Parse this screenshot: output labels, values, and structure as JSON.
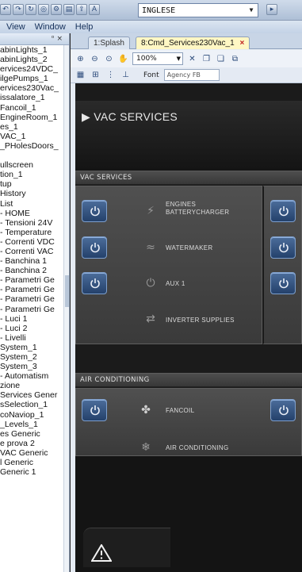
{
  "toolbar": {
    "language": "INGLESE"
  },
  "menu": {
    "items": [
      "View",
      "Window",
      "Help"
    ]
  },
  "left_panel": {
    "header": "&#x2d7; ×",
    "items": [
      "abinLights_1",
      "abinLights_2",
      "ervices24VDC_",
      "ilgePumps_1",
      "ervices230Vac_",
      "issalatore_1",
      "Fancoil_1",
      "EngineRoom_1",
      "es_1",
      "VAC_1",
      "_PHolesDoors_",
      "",
      "ullscreen",
      "tion_1",
      "tup",
      "History",
      "List",
      "- HOME",
      "- Tensioni 24V",
      "- Temperature",
      "- Correnti VDC",
      "- Correnti VAC",
      "- Banchina 1",
      "- Banchina 2",
      "- Parametri Ge",
      "- Parametri Ge",
      "- Parametri Ge",
      "- Parametri Ge",
      "- Luci 1",
      "- Luci 2",
      "- Livelli",
      "System_1",
      "System_2",
      "System_3",
      "- Automatism",
      "zione",
      "Services Gener",
      "sSelection_1",
      "coNaviop_1",
      "_Levels_1",
      "es Generic",
      "e prova 2",
      "VAC Generic",
      "l Generic",
      "Generic 1"
    ]
  },
  "tabs": [
    {
      "label": "1:Splash"
    },
    {
      "label": "8:Cmd_Services230Vac_1",
      "close": "×"
    }
  ],
  "zoombar": {
    "zoom": "100%"
  },
  "fontbar": {
    "label": "Font",
    "font_value": "Agency FB"
  },
  "page": {
    "title": "▶ VAC SERVICES",
    "sections": {
      "vac_services": "VAC SERVICES",
      "air_conditioning": "AIR CONDITIONING"
    },
    "vac_rows": [
      {
        "label_line1": "ENGINES",
        "label_line2": "BATTERYCHARGER",
        "icon": "battery-charger-icon",
        "has_button": true
      },
      {
        "label_line1": "WATERMAKER",
        "label_line2": "",
        "icon": "watermaker-icon",
        "has_button": true
      },
      {
        "label_line1": "AUX 1",
        "label_line2": "",
        "icon": "aux-power-icon",
        "has_button": true
      },
      {
        "label_line1": "INVERTER SUPPLIES",
        "label_line2": "",
        "icon": "inverter-icon",
        "has_button": false
      }
    ],
    "ac_rows": [
      {
        "label": "FANCOIL",
        "icon": "fan-icon",
        "has_button": true
      },
      {
        "label": "AIR CONDITIONING",
        "icon": "air-conditioning-icon",
        "has_button": false
      }
    ]
  },
  "colors": {
    "button_blue": "#2f5080",
    "page_background": "#1b1b1b",
    "section_bar": "#444444",
    "active_tab": "#fff7c4"
  }
}
